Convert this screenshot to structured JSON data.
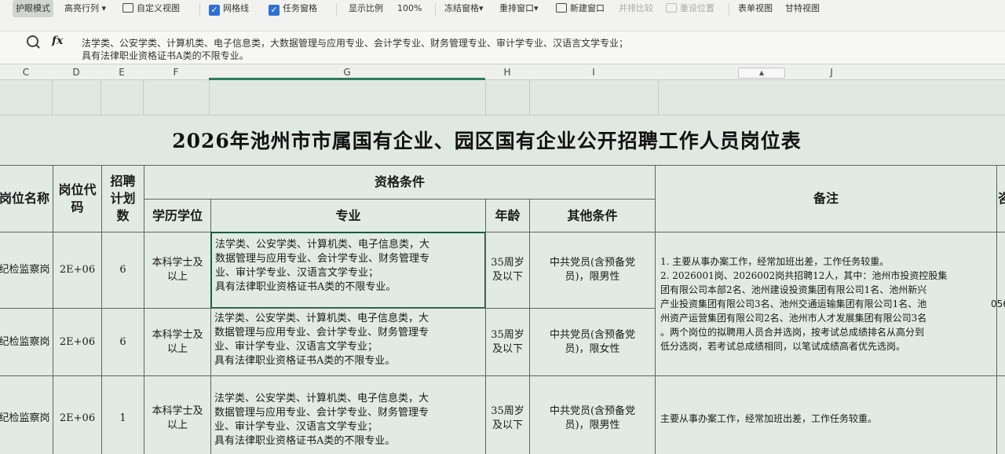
{
  "toolbar": {
    "protect_mode": "护眼模式",
    "highlight_rowcol": "高亮行列",
    "custom_view": "自定义视图",
    "gridlines": "网格线",
    "task_pane": "任务窗格",
    "zoom_label": "显示比例",
    "zoom_value": "100%",
    "freeze_panes": "冻结窗格",
    "arrange_windows": "重排窗口",
    "new_window": "新建窗口",
    "side_by_side": "并排比较",
    "reset_position": "重设位置",
    "form_view": "表单视图",
    "gantt_view": "甘特视图"
  },
  "formula_bar": {
    "content_line1": "法学类、公安学类、计算机类、电子信息类，大数据管理与应用专业、会计学专业、财务管理专业、审计学专业、汉语言文学专业；",
    "content_line2": "具有法律职业资格证书A类的不限专业。"
  },
  "columns": {
    "C": "C",
    "D": "D",
    "E": "E",
    "F": "F",
    "G": "G",
    "H": "H",
    "I": "I",
    "J": "J"
  },
  "sheet": {
    "title": "2026年池州市市属国有企业、园区国有企业公开招聘工作人员岗位表",
    "headers": {
      "position_name": "岗位名称",
      "position_code": "岗位代码",
      "hiring_plan": "招聘计划数",
      "qualifications": "资格条件",
      "education": "学历学位",
      "major": "专业",
      "age": "年龄",
      "other": "其他条件",
      "remarks": "备注",
      "clipped_col": "咨"
    },
    "rows": [
      {
        "name": "纪检监察岗",
        "code": "2E+06",
        "count": "6",
        "education": "本科学士及以上",
        "major_line1": "法学类、公安学类、计算机类、电子信息类，大",
        "major_line2": "数据管理与应用专业、会计学专业、财务管理专",
        "major_line3": "业、审计学专业、汉语言文学专业；",
        "major_line4": "具有法律职业资格证书A类的不限专业。",
        "age": "35周岁及以下",
        "other": "中共党员(含预备党员)，限男性"
      },
      {
        "name": "纪检监察岗",
        "code": "2E+06",
        "count": "6",
        "education": "本科学士及以上",
        "major_line1": "法学类、公安学类、计算机类、电子信息类，大",
        "major_line2": "数据管理与应用专业、会计学专业、财务管理专",
        "major_line3": "业、审计学专业、汉语言文学专业；",
        "major_line4": "具有法律职业资格证书A类的不限专业。",
        "age": "35周岁及以下",
        "other": "中共党员(含预备党员)，限女性"
      },
      {
        "name": "纪检监察岗",
        "code": "2E+06",
        "count": "1",
        "education": "本科学士及以上",
        "major_line1": "法学类、公安学类、计算机类、电子信息类，大",
        "major_line2": "数据管理与应用专业、会计学专业、财务管理专",
        "major_line3": "业、审计学专业、汉语言文学专业；",
        "major_line4": "具有法律职业资格证书A类的不限专业。",
        "age": "35周岁及以下",
        "other": "中共党员(含预备党员)，限男性",
        "remark": "主要从事办案工作，经常加班出差，工作任务较重。"
      }
    ],
    "remarks_merged": {
      "line1": "1. 主要从事办案工作，经常加班出差，工作任务较重。",
      "line2": "2. 2026001岗、2026002岗共招聘12人，其中：池州市投资控股集",
      "line3": "团有限公司本部2名、池州建设投资集团有限公司1名、池州新兴",
      "line4": "产业投资集团有限公司3名、池州交通运输集团有限公司1名、池",
      "line5": "州资产运营集团有限公司2名、池州市人才发展集团有限公司3名",
      "line6": "。两个岗位的拟聘用人员合并选岗，按考试总成绩排名从高分到",
      "line7": "低分选岗，若考试总成绩相同，以笔试成绩高者优先选岗。"
    },
    "clipped_value": "056"
  }
}
